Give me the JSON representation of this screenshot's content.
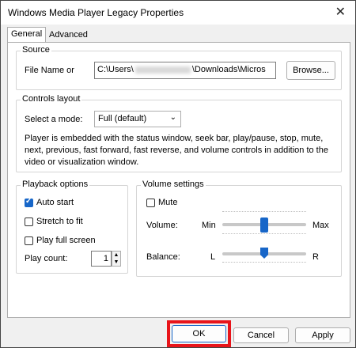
{
  "window": {
    "title": "Windows Media Player Legacy Properties",
    "close_glyph": "✕"
  },
  "tabs": [
    {
      "label": "General",
      "active": true
    },
    {
      "label": "Advanced",
      "active": false
    }
  ],
  "source": {
    "group_label": "Source",
    "file_label": "File Name or",
    "file_prefix": "C:\\Users\\",
    "file_suffix": "\\Downloads\\Micros",
    "browse_label": "Browse..."
  },
  "controls": {
    "group_label": "Controls layout",
    "mode_label": "Select a mode:",
    "mode_value": "Full (default)",
    "description": "Player is embedded with the status window, seek bar, play/pause, stop, mute, next, previous, fast forward, fast reverse, and volume controls in addition to the video or visualization window."
  },
  "playback": {
    "group_label": "Playback options",
    "auto_start": {
      "label": "Auto start",
      "checked": true
    },
    "stretch": {
      "label": "Stretch to fit",
      "checked": false
    },
    "fullscreen": {
      "label": "Play full screen",
      "checked": false
    },
    "count_label": "Play count:",
    "count_value": "1"
  },
  "volume": {
    "group_label": "Volume settings",
    "mute": {
      "label": "Mute",
      "checked": false
    },
    "volume_label": "Volume:",
    "volume_min": "Min",
    "volume_max": "Max",
    "volume_level": 0.5,
    "balance_label": "Balance:",
    "balance_left": "L",
    "balance_right": "R",
    "balance_level": 0.5
  },
  "buttons": {
    "ok": "OK",
    "cancel": "Cancel",
    "apply": "Apply"
  },
  "colors": {
    "accent": "#1766c8",
    "highlight": "#e8141a"
  },
  "icons": {
    "close": "close-icon",
    "chevron": "chevron-down-icon"
  }
}
